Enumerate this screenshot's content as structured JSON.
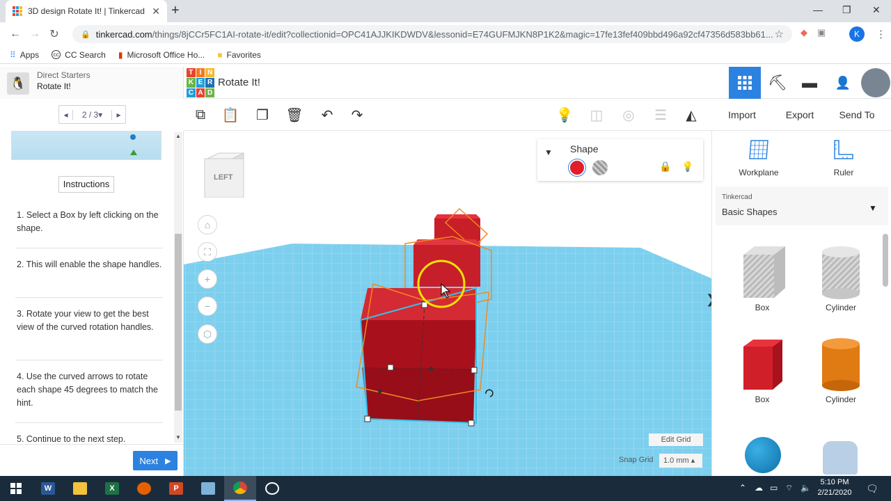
{
  "browser": {
    "tab_title": "3D design Rotate It! | Tinkercad",
    "url_host": "tinkercad.com",
    "url_rest": "/things/8jCCr5FC1AI-rotate-it/edit?collectionid=OPC41AJJKIKDWDV&lessonid=E74GUFMJKN8P1K2&magic=17fe13fef409bbd496a92cf47356d583bb61...",
    "profile_initial": "K",
    "bookmarks": [
      "Apps",
      "CC Search",
      "Microsoft Office Ho...",
      "Favorites"
    ]
  },
  "lesson": {
    "parent": "Direct Starters",
    "name": "Rotate It!",
    "pager": "2 / 3▾",
    "instructions_label": "Instructions",
    "steps": [
      "1. Select a Box by left clicking on the shape.",
      "2. This will enable the shape handles.",
      "3. Rotate your view to get the best view of the curved rotation handles.",
      "4. Use the curved arrows to rotate each shape 45 degrees to match the hint.",
      "5. Continue to the next step."
    ],
    "next_label": "Next"
  },
  "design": {
    "logo_letters": [
      "T",
      "I",
      "N",
      "K",
      "E",
      "R",
      "C",
      "A",
      "D"
    ],
    "title": "Rotate It!"
  },
  "toolbar": {
    "import": "Import",
    "export": "Export",
    "send_to": "Send To"
  },
  "viewcube_label": "LEFT",
  "shape_panel": {
    "title": "Shape",
    "solid_color": "#e21e2a"
  },
  "grid": {
    "edit_grid": "Edit Grid",
    "snap_label": "Snap Grid",
    "snap_value": "1.0 mm ▴"
  },
  "right_panel": {
    "workplane": "Workplane",
    "ruler": "Ruler",
    "library_owner": "Tinkercad",
    "library_name": "Basic Shapes",
    "shapes": [
      "Box",
      "Cylinder",
      "Box",
      "Cylinder"
    ]
  },
  "taskbar": {
    "time": "5:10 PM",
    "date": "2/21/2020"
  },
  "colors": {
    "accent": "#2c82e0",
    "shape_red": "#e21e2a",
    "grid_blue": "#74c9ea"
  }
}
